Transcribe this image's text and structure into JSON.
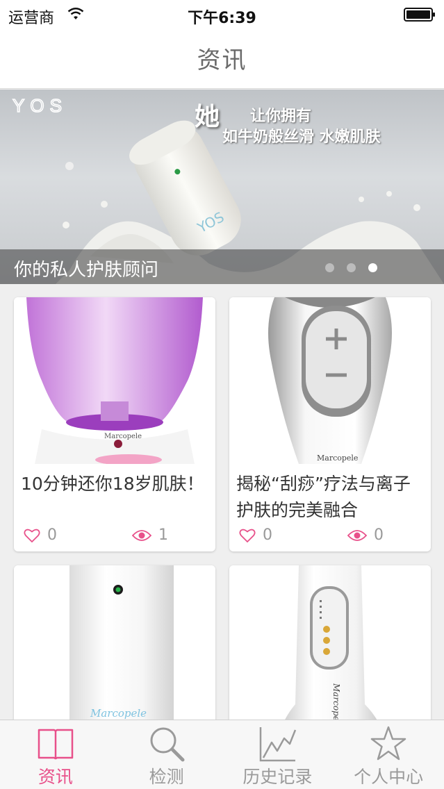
{
  "status_bar": {
    "carrier": "运营商",
    "time": "下午6:39"
  },
  "nav": {
    "title": "资讯"
  },
  "banner": {
    "brand": "YOS",
    "heading": "她",
    "line1": "让你拥有",
    "line2": "如牛奶般丝滑 水嫩肌肤",
    "caption": "你的私人护肤顾问",
    "pages": 3,
    "active_page": 3
  },
  "cards": [
    {
      "title": "10分钟还你18岁肌肤！",
      "likes": "0",
      "views": "1",
      "brand": "Marcopele"
    },
    {
      "title": "揭秘“刮痧”疗法与离子护肤的完美融合",
      "likes": "0",
      "views": "0",
      "brand": "Marcopele"
    },
    {
      "title": "",
      "brand": "Marcopele"
    },
    {
      "title": "",
      "brand": "Marcopele"
    }
  ],
  "tabs": [
    {
      "label": "资讯",
      "icon": "book-icon",
      "active": true
    },
    {
      "label": "检测",
      "icon": "search-icon",
      "active": false
    },
    {
      "label": "历史记录",
      "icon": "chart-icon",
      "active": false
    },
    {
      "label": "个人中心",
      "icon": "star-icon",
      "active": false
    }
  ],
  "colors": {
    "accent": "#e8508a",
    "inactive": "#9a9a9a",
    "like_icon": "#e8508a",
    "view_icon": "#e8508a"
  }
}
